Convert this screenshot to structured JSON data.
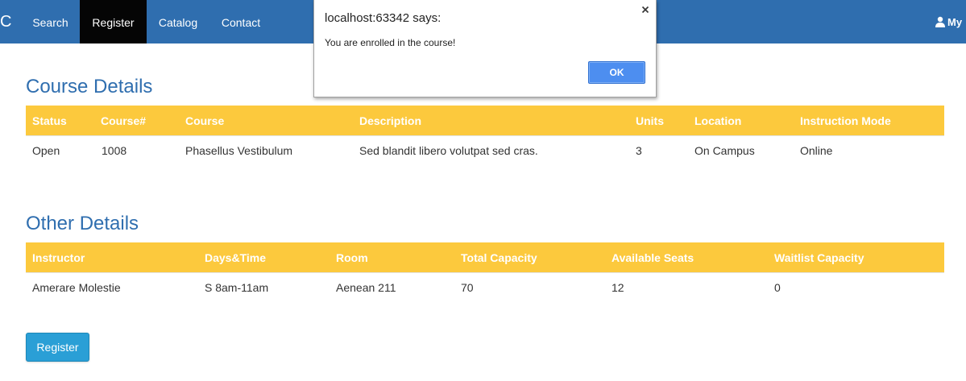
{
  "navbar": {
    "brand": "C",
    "items": [
      {
        "label": "Search"
      },
      {
        "label": "Register"
      },
      {
        "label": "Catalog"
      },
      {
        "label": "Contact"
      }
    ],
    "active": "Register",
    "user_label": "My"
  },
  "course_details": {
    "title": "Course Details",
    "headers": [
      "Status",
      "Course#",
      "Course",
      "Description",
      "Units",
      "Location",
      "Instruction Mode"
    ],
    "row": [
      "Open",
      "1008",
      "Phasellus Vestibulum",
      "Sed blandit libero volutpat sed cras.",
      "3",
      "On Campus",
      "Online"
    ]
  },
  "other_details": {
    "title": "Other Details",
    "headers": [
      "Instructor",
      "Days&Time",
      "Room",
      "Total Capacity",
      "Available Seats",
      "Waitlist Capacity"
    ],
    "row": [
      "Amerare Molestie",
      "S 8am-11am",
      "Aenean 211",
      "70",
      "12",
      "0"
    ]
  },
  "register_button": "Register",
  "dialog": {
    "title": "localhost:63342 says:",
    "message": "You are enrolled in the course!",
    "ok_label": "OK"
  },
  "colors": {
    "navbar": "#2f6eaf",
    "active_nav": "#050505",
    "table_header": "#fcc93d",
    "heading": "#2f6eaf",
    "register_button": "#2a9fd6",
    "dialog_ok": "#4d8ef0"
  }
}
